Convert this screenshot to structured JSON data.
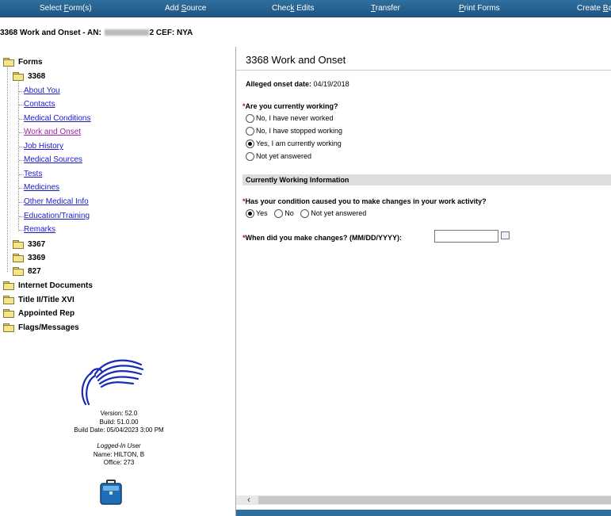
{
  "toolbar": {
    "items": [
      {
        "pre": "Select ",
        "u": "F",
        "post": "orm(s)"
      },
      {
        "pre": "Add ",
        "u": "S",
        "post": "ource"
      },
      {
        "pre": "Chec",
        "u": "k",
        "post": " Edits"
      },
      {
        "pre": "",
        "u": "T",
        "post": "ransfer"
      },
      {
        "pre": "",
        "u": "P",
        "post": "rint Forms"
      },
      {
        "pre": "Create ",
        "u": "B",
        "post": "a"
      }
    ]
  },
  "case": {
    "title_prefix": "3368 Work and Onset - AN: ",
    "title_suffix": "2 CEF: NYA"
  },
  "tree": {
    "forms": "Forms",
    "form_3368": "3368",
    "links": [
      "About You",
      "Contacts",
      "Medical Conditions",
      "Work and Onset",
      "Job History",
      "Medical Sources",
      "Tests",
      "Medicines",
      "Other Medical Info",
      "Education/Training",
      "Remarks"
    ],
    "form_3367": "3367",
    "form_3369": "3369",
    "form_827": "827",
    "internet_docs": "Internet Documents",
    "title_ii": "Title II/Title XVI",
    "appointed_rep": "Appointed Rep",
    "flags": "Flags/Messages"
  },
  "info": {
    "version": "Version: 52.0",
    "build": "Build: 51.0.00",
    "build_date": "Build Date: 05/04/2023 3:00 PM",
    "logged_in": "Logged-In User",
    "name": "Name: HILTON, B",
    "office": "Office: 273"
  },
  "form": {
    "title": "3368 Work and Onset",
    "onset_label": "Alleged onset date:",
    "onset_value": "04/19/2018",
    "q_working": "Are you currently working?",
    "working_options": [
      "No, I have never worked",
      "No, I have stopped working",
      "Yes, I am currently working",
      "Not yet answered"
    ],
    "working_selected": 2,
    "section_title": "Currently Working Information",
    "q_changes": "Has your condition caused you to make changes in your work activity?",
    "changes_options": [
      "Yes",
      "No",
      "Not yet answered"
    ],
    "changes_selected": 0,
    "q_when": "When did you make changes? (MM/DD/YYYY):",
    "when_value": "",
    "required_mark": "*"
  },
  "colors": {
    "toolbar": "#2f6f9e",
    "link": "#1a1acb",
    "visited_link": "#a020a0",
    "required": "#cc0000"
  }
}
